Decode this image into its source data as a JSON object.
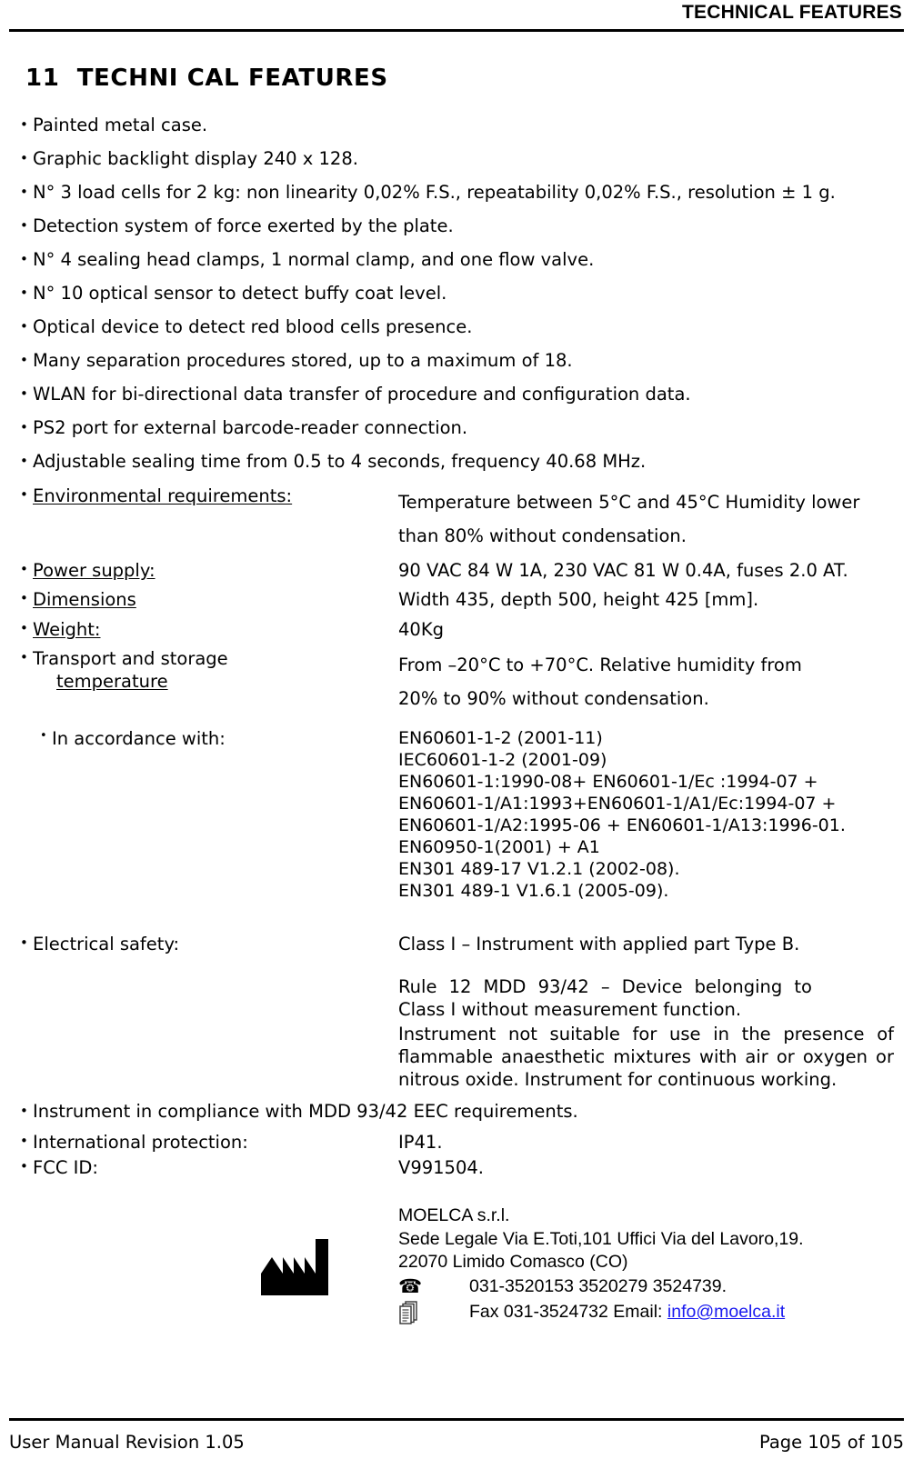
{
  "header": {
    "running_title": "TECHNICAL FEATURES"
  },
  "section": {
    "number": "11",
    "title": "TECHNI CAL FEATURES"
  },
  "bullets": [
    "Painted metal case.",
    "Graphic backlight display 240 x 128.",
    "N° 3 load cells for 2 kg: non linearity 0,02% F.S., repeatability 0,02% F.S., resolution ± 1 g.",
    "Detection system of force exerted by the plate.",
    "N° 4 sealing head clamps, 1 normal clamp, and one flow valve.",
    "N° 10 optical sensor to detect buffy coat level.",
    "Optical device to detect red blood cells presence.",
    "Many separation procedures stored, up to a maximum of 18.",
    "WLAN for bi-directional data transfer of procedure and configuration data.",
    "PS2  port for external barcode-reader connection.",
    "Adjustable sealing time from 0.5 to 4 seconds, frequency 40.68 MHz."
  ],
  "specs": {
    "environmental": {
      "label": "Environmental requirements:",
      "value_line1": "Temperature between 5°C and 45°C Humidity lower",
      "value_line2": "than 80% without condensation."
    },
    "power": {
      "label": "Power supply:",
      "value": "90 VAC 84 W 1A, 230 VAC 81 W 0.4A, fuses 2.0 AT."
    },
    "dimensions": {
      "label": "Dimensions",
      "value": "Width 435, depth 500, height 425 [mm]."
    },
    "weight": {
      "label": "Weight:",
      "value": "40Kg"
    },
    "transport": {
      "label_line1": "Transport and storage ",
      "label_line2": "temperature",
      "value_line1": "From –20°C to +70°C. Relative humidity from",
      "value_line2": "20% to 90% without condensation."
    },
    "accordance": {
      "label": "In accordance with:",
      "standards": "EN60601-1-2 (2001-11)\nIEC60601-1-2 (2001-09)\nEN60601-1:1990-08+ EN60601-1/Ec :1994-07 +\nEN60601-1/A1:1993+EN60601-1/A1/Ec:1994-07 +\nEN60601-1/A2:1995-06 + EN60601-1/A13:1996-01.\nEN60950-1(2001) + A1\nEN301 489-17 V1.2.1 (2002-08).\nEN301 489-1 V1.6.1 (2005-09)."
    },
    "electrical_safety": {
      "label": "Electrical safety:",
      "value_line1": "Class I – Instrument with applied part Type B.",
      "value_para1": "Rule 12 MDD 93/42 – Device belonging to Class I without measurement function.",
      "value_para2": "Instrument not suitable for use in the presence of flammable anaesthetic mixtures with air or oxygen or nitrous oxide. Instrument for continuous working."
    },
    "compliance": "Instrument in compliance with MDD 93/42 EEC requirements.",
    "international_protection": {
      "label": "International protection:",
      "value": "IP41."
    },
    "fcc_id": {
      "label": "FCC ID:",
      "value": "V991504."
    }
  },
  "manufacturer": {
    "icon_name": "factory-icon",
    "name": "MOELCA s.r.l.",
    "address_line1": "Sede Legale Via E.Toti,101 Uffici Via del Lavoro,19.",
    "address_line2": "22070 Limido Comasco (CO)",
    "phone_icon_name": "telephone-icon",
    "phone": "031-3520153 3520279 3524739.",
    "fax_icon_name": "fax-icon",
    "fax_label": "Fax 031-3524732 Email: ",
    "email": "info@moelca.it",
    "email_color": "#1a1af0"
  },
  "footer": {
    "left": "User Manual Revision 1.05",
    "right": "Page 105 of 105"
  }
}
